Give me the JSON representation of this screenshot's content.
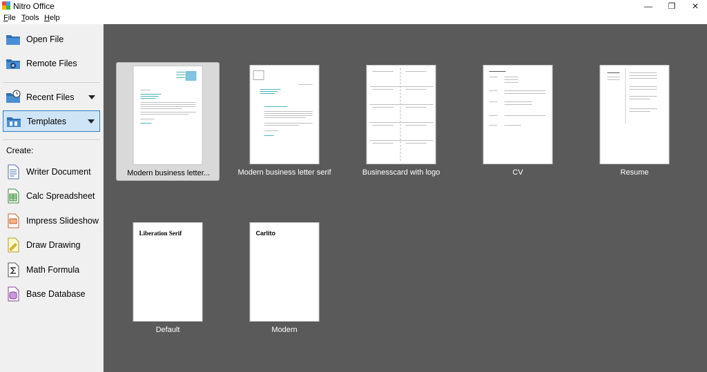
{
  "window": {
    "title": "Nitro Office",
    "controls": {
      "minimize": "—",
      "restore": "❐",
      "close": "✕"
    }
  },
  "menu": [
    {
      "label": "File",
      "accel": "F"
    },
    {
      "label": "Tools",
      "accel": "T"
    },
    {
      "label": "Help",
      "accel": "H"
    }
  ],
  "sidebar": {
    "open_file": "Open File",
    "remote_files": "Remote Files",
    "recent_files": "Recent Files",
    "templates": "Templates",
    "create_label": "Create:",
    "create_items": [
      {
        "label": "Writer Document",
        "icon": "writer-icon"
      },
      {
        "label": "Calc Spreadsheet",
        "icon": "calc-icon"
      },
      {
        "label": "Impress Slideshow",
        "icon": "impress-icon"
      },
      {
        "label": "Draw Drawing",
        "icon": "draw-icon"
      },
      {
        "label": "Math Formula",
        "icon": "math-icon"
      },
      {
        "label": "Base Database",
        "icon": "base-icon"
      }
    ]
  },
  "templates": [
    {
      "label": "Modern business letter...",
      "selected": true
    },
    {
      "label": "Modern business letter serif",
      "selected": false
    },
    {
      "label": "Businesscard with logo",
      "selected": false
    },
    {
      "label": "CV",
      "selected": false
    },
    {
      "label": "Resume",
      "selected": false
    },
    {
      "label": "Default",
      "selected": false,
      "preview_text": "Liberation Serif"
    },
    {
      "label": "Modern",
      "selected": false,
      "preview_text": "Carlito"
    }
  ],
  "colors": {
    "canvas": "#5a5a5a",
    "sidebar": "#f0f0f0",
    "accent": "#2f7ec4",
    "selection": "#cfe4f7"
  }
}
